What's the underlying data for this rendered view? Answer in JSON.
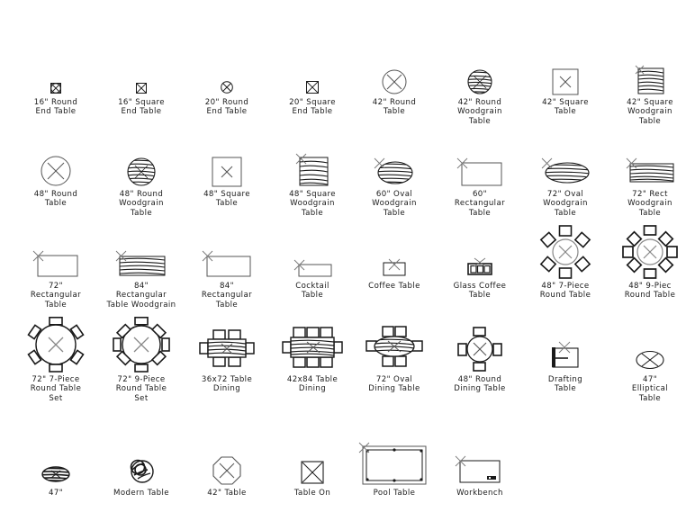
{
  "sheet": {
    "title": "CAD furniture table blocks legend sheet",
    "background_color": "#ffffff",
    "line_color": "#1a1a1a",
    "grid": {
      "rows": 5,
      "columns": 8
    }
  },
  "items": [
    {
      "id": "r1c1",
      "icon": "round-end-table-16-icon",
      "label": "16\" Round\nEnd Table"
    },
    {
      "id": "r1c2",
      "icon": "square-end-table-16-icon",
      "label": "16\" Square\nEnd Table"
    },
    {
      "id": "r1c3",
      "icon": "round-end-table-20-icon",
      "label": "20\" Round\nEnd Table"
    },
    {
      "id": "r1c4",
      "icon": "square-end-table-20-icon",
      "label": "20\" Square\nEnd Table"
    },
    {
      "id": "r1c5",
      "icon": "round-table-42-icon",
      "label": "42\" Round\nTable"
    },
    {
      "id": "r1c6",
      "icon": "round-woodgrain-table-42-icon",
      "label": "42\" Round\nWoodgrain\nTable"
    },
    {
      "id": "r1c7",
      "icon": "square-table-42-icon",
      "label": "42\" Square\nTable"
    },
    {
      "id": "r1c8",
      "icon": "square-woodgrain-table-42-icon",
      "label": "42\" Square\nWoodgrain\nTable"
    },
    {
      "id": "r2c1",
      "icon": "round-table-48-icon",
      "label": "48\" Round\nTable"
    },
    {
      "id": "r2c2",
      "icon": "round-woodgrain-table-48-icon",
      "label": "48\" Round\nWoodgrain\nTable"
    },
    {
      "id": "r2c3",
      "icon": "square-table-48-icon",
      "label": "48\" Square\nTable"
    },
    {
      "id": "r2c4",
      "icon": "square-woodgrain-table-48-icon",
      "label": "48\" Square\nWoodgrain\nTable"
    },
    {
      "id": "r2c5",
      "icon": "oval-woodgrain-table-60-icon",
      "label": "60\" Oval\nWoodgrain\nTable"
    },
    {
      "id": "r2c6",
      "icon": "rectangular-table-60-icon",
      "label": "60\"\nRectangular\nTable"
    },
    {
      "id": "r2c7",
      "icon": "oval-woodgrain-table-72-icon",
      "label": "72\" Oval\nWoodgrain\nTable"
    },
    {
      "id": "r2c8",
      "icon": "rect-woodgrain-table-72-icon",
      "label": "72\" Rect\nWoodgrain\nTable"
    },
    {
      "id": "r3c1",
      "icon": "rectangular-table-72-icon",
      "label": "72\"\nRectangular\nTable"
    },
    {
      "id": "r3c2",
      "icon": "rectangular-woodgrain-table-84-icon",
      "label": "84\"\nRectangular\nTable Woodgrain"
    },
    {
      "id": "r3c3",
      "icon": "rectangular-table-84-icon",
      "label": "84\"\nRectangular\nTable"
    },
    {
      "id": "r3c4",
      "icon": "cocktail-table-icon",
      "label": "Cocktail\nTable"
    },
    {
      "id": "r3c5",
      "icon": "coffee-table-icon",
      "label": "Coffee Table"
    },
    {
      "id": "r3c6",
      "icon": "glass-coffee-table-icon",
      "label": "Glass Coffee\nTable"
    },
    {
      "id": "r3c7",
      "icon": "round-table-7-piece-48-icon",
      "label": "48\" 7-Piece\nRound Table"
    },
    {
      "id": "r3c8",
      "icon": "round-table-9-piece-48-icon",
      "label": "48\" 9-Piec\nRound Table"
    },
    {
      "id": "r4c1",
      "icon": "round-table-set-7-piece-72-icon",
      "label": "72\" 7-Piece\nRound Table\nSet"
    },
    {
      "id": "r4c2",
      "icon": "round-table-set-9-piece-72-icon",
      "label": "72\" 9-Piece\nRound Table\nSet"
    },
    {
      "id": "r4c3",
      "icon": "dining-table-36x72-icon",
      "label": "36x72 Table\nDining"
    },
    {
      "id": "r4c4",
      "icon": "dining-table-42x84-icon",
      "label": "42x84 Table\nDining"
    },
    {
      "id": "r4c5",
      "icon": "oval-dining-table-72-icon",
      "label": "72\" Oval\nDining Table"
    },
    {
      "id": "r4c6",
      "icon": "round-dining-table-48-icon",
      "label": "48\" Round\nDining Table"
    },
    {
      "id": "r4c7",
      "icon": "drafting-table-icon",
      "label": "Drafting\nTable"
    },
    {
      "id": "r4c8",
      "icon": "elliptical-table-47-icon",
      "label": "47\"\nElliptical\nTable"
    },
    {
      "id": "r5c1",
      "icon": "oval-woodgrain-table-47-icon",
      "label": "47\""
    },
    {
      "id": "r5c2",
      "icon": "modern-table-icon",
      "label": "Modern Table"
    },
    {
      "id": "r5c3",
      "icon": "octagon-table-42-icon",
      "label": "42\" Table"
    },
    {
      "id": "r5c4",
      "icon": "table-on-icon",
      "label": "Table On"
    },
    {
      "id": "r5c5",
      "icon": "pool-table-icon",
      "label": "Pool Table"
    },
    {
      "id": "r5c6",
      "icon": "workbench-icon",
      "label": "Workbench"
    }
  ]
}
